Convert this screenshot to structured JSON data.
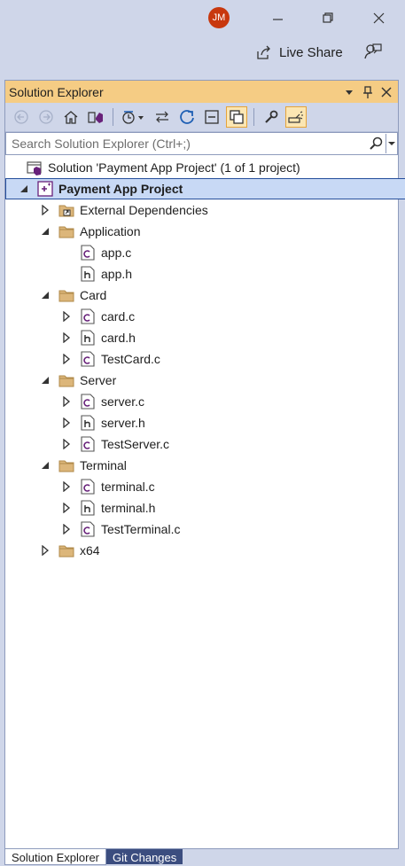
{
  "titlebar": {
    "avatar_initials": "JM",
    "live_share_label": "Live Share",
    "buttons": [
      "minimize-icon",
      "restore-icon",
      "close-icon"
    ]
  },
  "panel": {
    "title": "Solution Explorer",
    "header_buttons": [
      "dropdown-icon",
      "pin-icon",
      "close-icon"
    ],
    "toolbar_icons": [
      "back-icon",
      "forward-icon",
      "home-icon",
      "switch-views-icon",
      "pending-changes-filter-icon",
      "sync-icon",
      "refresh-icon",
      "collapse-all-icon",
      "show-all-files-icon",
      "properties-icon",
      "preview-selected-icon"
    ],
    "search_placeholder": "Search Solution Explorer (Ctrl+;)"
  },
  "tree": {
    "items": [
      {
        "label": "Solution 'Payment App Project' (1 of 1 project)",
        "icon": "solution-icon",
        "expander": "none",
        "level": 0
      },
      {
        "label": "Payment App Project",
        "icon": "project-icon",
        "expander": "expanded",
        "level": 0,
        "selected": true
      },
      {
        "label": "External Dependencies",
        "icon": "external-deps-icon",
        "expander": "collapsed",
        "level": 1
      },
      {
        "label": "Application",
        "icon": "folder-icon",
        "expander": "expanded",
        "level": 1
      },
      {
        "label": "app.c",
        "icon": "c-file-icon",
        "expander": "none",
        "level": 2
      },
      {
        "label": "app.h",
        "icon": "h-file-icon",
        "expander": "none",
        "level": 2
      },
      {
        "label": "Card",
        "icon": "folder-icon",
        "expander": "expanded",
        "level": 1
      },
      {
        "label": "card.c",
        "icon": "c-file-icon",
        "expander": "collapsed",
        "level": 2
      },
      {
        "label": "card.h",
        "icon": "h-file-icon",
        "expander": "collapsed",
        "level": 2
      },
      {
        "label": "TestCard.c",
        "icon": "c-file-icon",
        "expander": "collapsed",
        "level": 2
      },
      {
        "label": "Server",
        "icon": "folder-icon",
        "expander": "expanded",
        "level": 1
      },
      {
        "label": "server.c",
        "icon": "c-file-icon",
        "expander": "collapsed",
        "level": 2
      },
      {
        "label": "server.h",
        "icon": "h-file-icon",
        "expander": "collapsed",
        "level": 2
      },
      {
        "label": "TestServer.c",
        "icon": "c-file-icon",
        "expander": "collapsed",
        "level": 2
      },
      {
        "label": "Terminal",
        "icon": "folder-icon",
        "expander": "expanded",
        "level": 1
      },
      {
        "label": "terminal.c",
        "icon": "c-file-icon",
        "expander": "collapsed",
        "level": 2
      },
      {
        "label": "terminal.h",
        "icon": "h-file-icon",
        "expander": "collapsed",
        "level": 2
      },
      {
        "label": "TestTerminal.c",
        "icon": "c-file-icon",
        "expander": "collapsed",
        "level": 2
      },
      {
        "label": "x64",
        "icon": "folder-icon",
        "expander": "collapsed",
        "level": 1
      }
    ]
  },
  "bottom_tabs": [
    {
      "label": "Solution Explorer",
      "active": true
    },
    {
      "label": "Git Changes",
      "active": false
    }
  ],
  "colors": {
    "chrome": "#cfd6e9",
    "header_active": "#f5cc84",
    "selection": "#c8d9f5",
    "avatar": "#c8380e"
  }
}
